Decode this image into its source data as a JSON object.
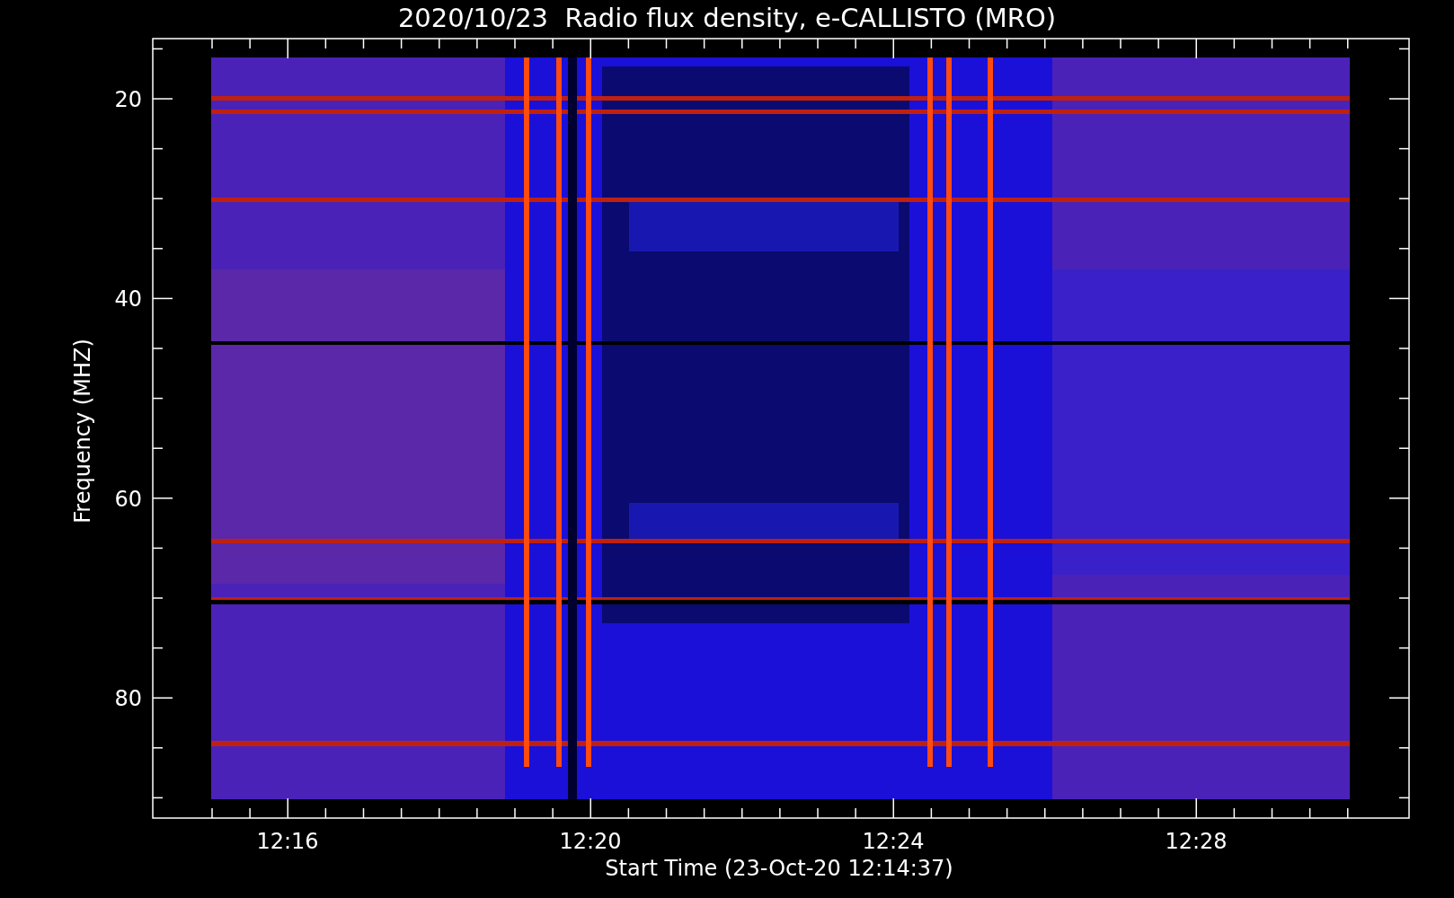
{
  "title": "2020/10/23  Radio flux density, e-CALLISTO (MRO)",
  "y_axis": {
    "label": "Frequency (MHZ)",
    "ticks": [
      "20",
      "40",
      "60",
      "80"
    ]
  },
  "x_axis": {
    "label": "Start Time (23-Oct-20 12:14:37)",
    "ticks": [
      "12:16",
      "12:20",
      "12:24",
      "12:28"
    ]
  }
}
